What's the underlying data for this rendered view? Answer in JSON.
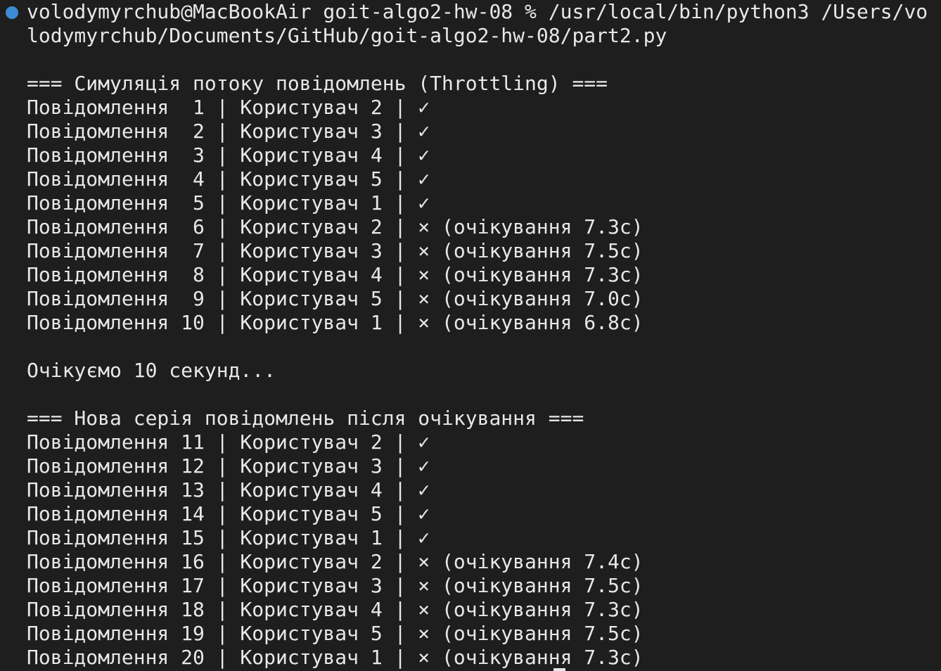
{
  "terminal": {
    "prompt_status_color": "#3d8ad6",
    "command_line_1": "volodymyrchub@MacBookAir goit-algo2-hw-08 % /usr/local/bin/python3 /Users/vo",
    "command_line_2": "lodymyrchub/Documents/GitHub/goit-algo2-hw-08/part2.py",
    "section1_header": "=== Симуляція потоку повідомлень (Throttling) ===",
    "section1_lines": [
      "Повідомлення  1 | Користувач 2 | ✓",
      "Повідомлення  2 | Користувач 3 | ✓",
      "Повідомлення  3 | Користувач 4 | ✓",
      "Повідомлення  4 | Користувач 5 | ✓",
      "Повідомлення  5 | Користувач 1 | ✓",
      "Повідомлення  6 | Користувач 2 | × (очікування 7.3с)",
      "Повідомлення  7 | Користувач 3 | × (очікування 7.5с)",
      "Повідомлення  8 | Користувач 4 | × (очікування 7.3с)",
      "Повідомлення  9 | Користувач 5 | × (очікування 7.0с)",
      "Повідомлення 10 | Користувач 1 | × (очікування 6.8с)"
    ],
    "wait_message": "Очікуємо 10 секунд...",
    "section2_header": "=== Нова серія повідомлень після очікування ===",
    "section2_lines": [
      "Повідомлення 11 | Користувач 2 | ✓",
      "Повідомлення 12 | Користувач 3 | ✓",
      "Повідомлення 13 | Користувач 4 | ✓",
      "Повідомлення 14 | Користувач 5 | ✓",
      "Повідомлення 15 | Користувач 1 | ✓",
      "Повідомлення 16 | Користувач 2 | × (очікування 7.4с)",
      "Повідомлення 17 | Користувач 3 | × (очікування 7.5с)",
      "Повідомлення 18 | Користувач 4 | × (очікування 7.3с)",
      "Повідомлення 19 | Користувач 5 | × (очікування 7.5с)",
      "Повідомлення 20 | Користувач 1 | × (очікування 7.3с)"
    ]
  }
}
